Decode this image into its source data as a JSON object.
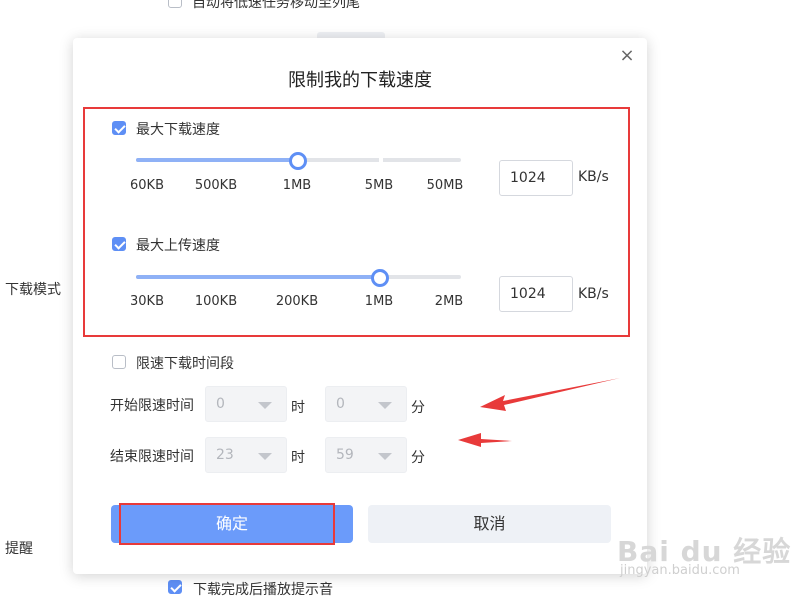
{
  "background": {
    "top_option": "自动将低速任务移动至列尾",
    "download_mode_label": "下载模式",
    "remind_label": "提醒",
    "bottom_option": "下载完成后播放提示音"
  },
  "dialog": {
    "title": "限制我的下载速度",
    "close": "×",
    "download_limit": {
      "label": "最大下载速度",
      "checked": true,
      "ticks": [
        "60KB",
        "500KB",
        "1MB",
        "5MB",
        "50MB"
      ],
      "value": "1024",
      "unit": "KB/s"
    },
    "upload_limit": {
      "label": "最大上传速度",
      "checked": true,
      "ticks": [
        "30KB",
        "100KB",
        "200KB",
        "1MB",
        "2MB"
      ],
      "value": "1024",
      "unit": "KB/s"
    },
    "schedule": {
      "label": "限速下载时间段",
      "checked": false,
      "start_label": "开始限速时间",
      "end_label": "结束限速时间",
      "start_hour": "0",
      "start_minute": "0",
      "end_hour": "23",
      "end_minute": "59",
      "hour_unit": "时",
      "minute_unit": "分"
    },
    "confirm": "确定",
    "cancel": "取消"
  },
  "watermark": {
    "logo": "Bai du 经验",
    "url": "jingyan.baidu.com"
  },
  "colors": {
    "accent": "#5e8ff5",
    "annotation": "#e83a3a"
  }
}
